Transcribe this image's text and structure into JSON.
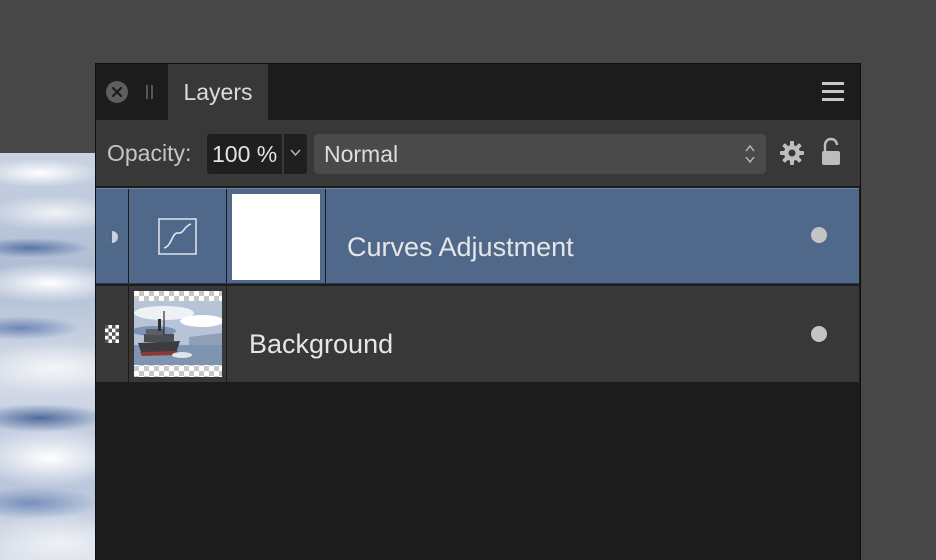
{
  "panel": {
    "tab_label": "Layers",
    "opacity_label": "Opacity:",
    "opacity_value": "100 %",
    "blend_mode": "Normal"
  },
  "layers": [
    {
      "name": "Curves Adjustment",
      "selected": true
    },
    {
      "name": "Background",
      "selected": false
    }
  ],
  "colors": {
    "selected_row": "#50698a",
    "panel_bg": "#1c1c1c",
    "toolbar_bg": "#383838"
  },
  "icons": [
    "close-icon",
    "grip-icon",
    "hamburger-menu-icon",
    "chevron-down-icon",
    "up-down-arrows-icon",
    "gear-icon",
    "lock-icon",
    "curves-icon",
    "half-circle-icon",
    "checkerboard-icon",
    "visibility-dot-icon"
  ]
}
